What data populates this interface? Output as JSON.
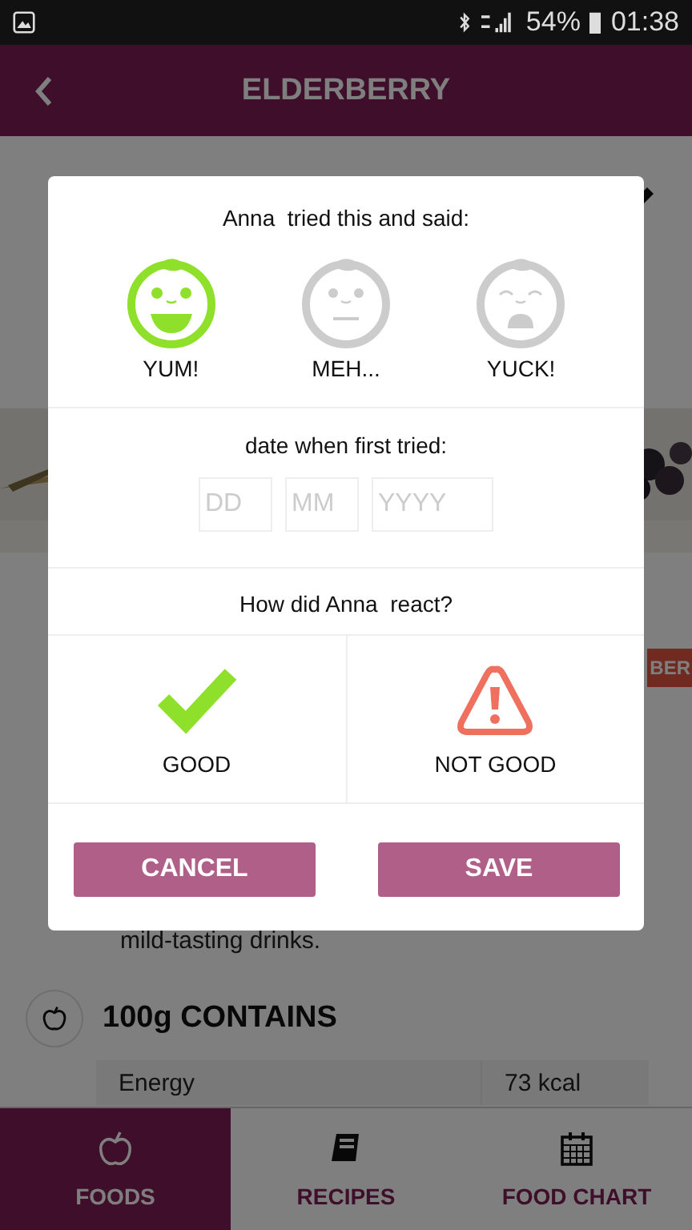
{
  "status_bar": {
    "battery": "54%",
    "time": "01:38"
  },
  "app_bar": {
    "title": "ELDERBERRY"
  },
  "background": {
    "badge": "BER",
    "text": "mild-tasting drinks.",
    "section_title": "100g CONTAINS",
    "table": {
      "rows": [
        {
          "name": "Energy",
          "value": "73 kcal"
        }
      ]
    }
  },
  "dialog": {
    "title": "Anna  tried this and said:",
    "faces": [
      {
        "kind": "yum",
        "label": "YUM!",
        "selected": true
      },
      {
        "kind": "meh",
        "label": "MEH...",
        "selected": false
      },
      {
        "kind": "yuck",
        "label": "YUCK!",
        "selected": false
      }
    ],
    "date_title": "date when first tried:",
    "date_fields": [
      {
        "placeholder": "DD"
      },
      {
        "placeholder": "MM"
      },
      {
        "placeholder": "YYYY"
      }
    ],
    "react_title": "How did Anna  react?",
    "reactions": [
      {
        "kind": "good",
        "label": "GOOD"
      },
      {
        "kind": "bad",
        "label": "NOT GOOD"
      }
    ],
    "buttons": [
      {
        "label": "CANCEL"
      },
      {
        "label": "SAVE"
      }
    ]
  },
  "nav": [
    {
      "kind": "foods",
      "label": "FOODS",
      "selected": true
    },
    {
      "kind": "recipes",
      "label": "RECIPES",
      "selected": false
    },
    {
      "kind": "chart",
      "label": "FOOD CHART",
      "selected": false
    }
  ]
}
